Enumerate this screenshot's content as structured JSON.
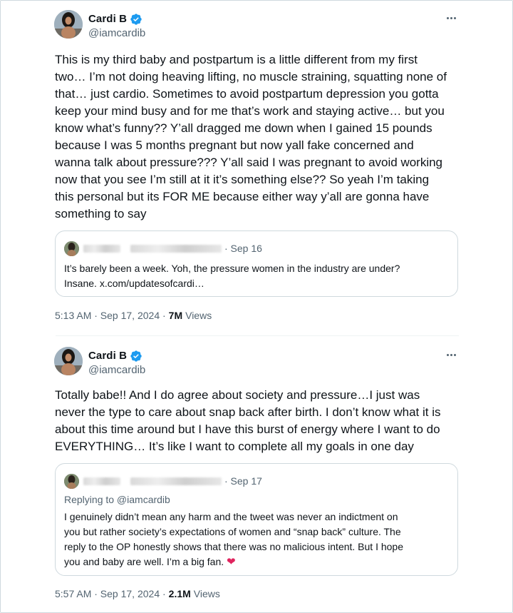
{
  "tweets": [
    {
      "author": {
        "name": "Cardi B",
        "handle": "@iamcardib",
        "verified": true
      },
      "text": "This is my third baby and postpartum is a little different from my first\ntwo… I’m not doing heaving lifting, no muscle straining, squatting none of\nthat… just cardio. Sometimes to avoid postpartum depression you gotta\nkeep your mind busy and for me that’s work and staying active… but you\nknow what’s funny?? Y’all dragged me down when I gained 15 pounds\nbecause I was 5 months pregnant but now yall fake concerned and\nwanna talk about pressure??? Y’all said I was pregnant to avoid working\nnow that you see I’m still at it it’s something else?? So yeah I’m  taking\nthis personal but its FOR ME because either way y’all are gonna have\nsomething to say",
      "quote": {
        "date": "· Sep 16",
        "text": "It’s barely been a week. Yoh, the pressure women in the industry are under?\nInsane. x.com/updatesofcardi…"
      },
      "time": "5:13 AM · Sep 17, 2024 ·",
      "views_count": "7M",
      "views_label": "Views"
    },
    {
      "author": {
        "name": "Cardi B",
        "handle": "@iamcardib",
        "verified": true
      },
      "text": "Totally babe!! And I do agree about society and pressure…I just was\nnever the type to care about snap back after birth. I don’t know what it is\nabout this time around but I have this burst of energy where I want to do\nEVERYTHING… It’s like I want to complete all my goals in one day",
      "quote": {
        "date": "· Sep 17",
        "replying_to": "Replying to @iamcardib",
        "text": "I genuinely didn’t mean any harm and the tweet was never an indictment on\nyou but rather society’s expectations of women and “snap back” culture. The\nreply to the OP honestly shows that there was no malicious intent. But I hope\nyou and baby are well. I’m a big fan.",
        "emoji": "❤"
      },
      "time": "5:57 AM · Sep 17, 2024 ·",
      "views_count": "2.1M",
      "views_label": "Views"
    }
  ],
  "colors": {
    "verified": "#1d9bf0",
    "secondary_text": "#536471",
    "border": "#cfd9de",
    "heart": "#e0245e"
  },
  "icons": [
    "verified-badge-icon",
    "more-options-icon",
    "heart-emoji"
  ]
}
